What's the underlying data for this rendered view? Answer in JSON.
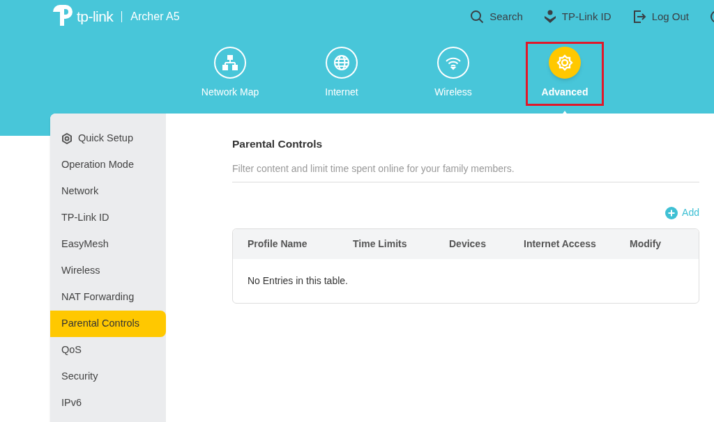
{
  "header": {
    "brand": "tp-link",
    "model": "Archer A5",
    "actions": [
      {
        "kind": "search",
        "label": "Search"
      },
      {
        "kind": "id",
        "label": "TP-Link ID"
      },
      {
        "kind": "logout",
        "label": "Log Out"
      },
      {
        "kind": "cut"
      }
    ]
  },
  "nav": [
    {
      "kind": "map",
      "label": "Network Map",
      "selected": false,
      "highlighted": false
    },
    {
      "kind": "globe",
      "label": "Internet",
      "selected": false,
      "highlighted": false
    },
    {
      "kind": "wifi",
      "label": "Wireless",
      "selected": false,
      "highlighted": false
    },
    {
      "kind": "gear",
      "label": "Advanced",
      "selected": true,
      "highlighted": true
    }
  ],
  "sidebar": {
    "items": [
      {
        "label": "Quick Setup",
        "kind": "icon",
        "selected": false
      },
      {
        "label": "Operation Mode",
        "kind": "plain",
        "selected": false
      },
      {
        "label": "Network",
        "kind": "plain",
        "selected": false
      },
      {
        "label": "TP-Link ID",
        "kind": "plain",
        "selected": false
      },
      {
        "label": "EasyMesh",
        "kind": "plain",
        "selected": false
      },
      {
        "label": "Wireless",
        "kind": "plain",
        "selected": false
      },
      {
        "label": "NAT Forwarding",
        "kind": "plain",
        "selected": false
      },
      {
        "label": "Parental Controls",
        "kind": "plain",
        "selected": true
      },
      {
        "label": "QoS",
        "kind": "plain",
        "selected": false
      },
      {
        "label": "Security",
        "kind": "plain",
        "selected": false
      },
      {
        "label": "IPv6",
        "kind": "plain",
        "selected": false
      }
    ]
  },
  "section": {
    "title": "Parental Controls",
    "description": "Filter content and limit time spent online for your family members.",
    "add_button": "Add"
  },
  "table": {
    "columns": [
      "Profile Name",
      "Time Limits",
      "Devices",
      "Internet Access",
      "Modify"
    ],
    "empty_message": "No Entries in this table."
  }
}
